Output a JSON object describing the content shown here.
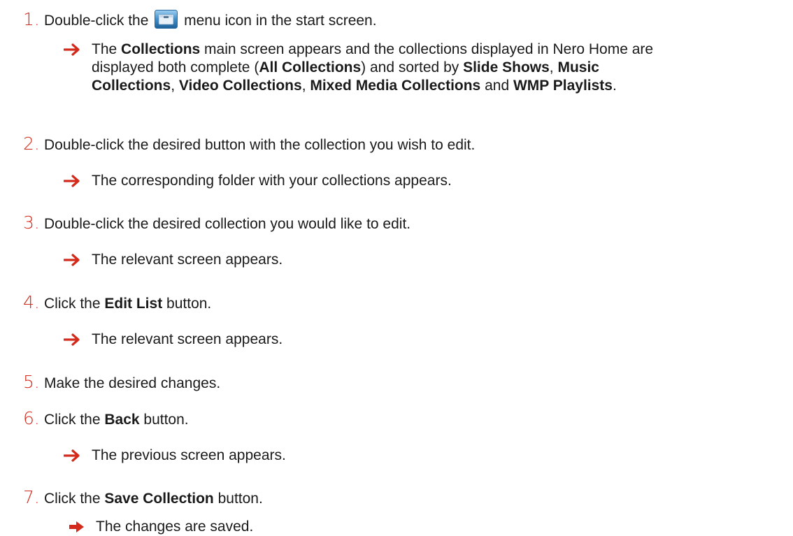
{
  "colors": {
    "step_number": "#d42a1c",
    "arrow": "#d42a1c",
    "text": "#1a1a1a"
  },
  "icons": {
    "menu_icon": "collections-menu-icon",
    "arrow": "arrow-right-icon"
  },
  "steps": [
    {
      "num": "1.",
      "text_before": "Double-click the",
      "text_after": "menu icon in the start screen.",
      "result": {
        "t1": "The ",
        "b1": "Collections",
        "t2": " main screen appears and the collections displayed in Nero Home are",
        "t3": "displayed both complete (",
        "b2": "All Collections",
        "t4": ") and sorted by ",
        "b3": "Slide Shows",
        "t5": ", ",
        "b4": "Music",
        "b5": "Collections",
        "t6": ", ",
        "b6": "Video Collections",
        "t7": ", ",
        "b7": "Mixed Media Collections",
        "t8": " and ",
        "b8": "WMP Playlists",
        "t9": "."
      }
    },
    {
      "num": "2.",
      "text": "Double-click the desired button with the collection you wish to edit.",
      "result": "The corresponding folder with your collections appears."
    },
    {
      "num": "3.",
      "text": "Double-click the desired collection you would like to edit.",
      "result": "The relevant screen appears."
    },
    {
      "num": "4.",
      "t1": "Click the ",
      "b1": "Edit List",
      "t2": " button.",
      "result": "The relevant screen appears."
    },
    {
      "num": "5.",
      "text": "Make the desired changes."
    },
    {
      "num": "6.",
      "t1": "Click the ",
      "b1": "Back",
      "t2": " button.",
      "result": "The previous screen appears."
    },
    {
      "num": "7.",
      "t1": "Click the ",
      "b1": "Save Collection",
      "t2": " button.",
      "result": "The changes are saved."
    }
  ]
}
